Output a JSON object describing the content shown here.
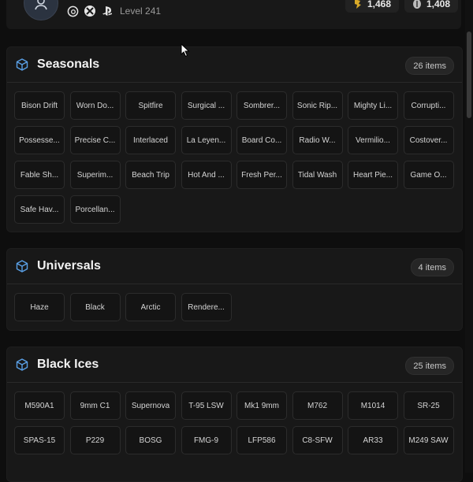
{
  "header": {
    "level_text": "Level 241",
    "platforms": [
      "ubisoft-icon",
      "xbox-icon",
      "playstation-icon"
    ],
    "currencies": [
      {
        "icon": "renown-icon",
        "value": "1,468"
      },
      {
        "icon": "credits-icon",
        "value": "1,408"
      }
    ]
  },
  "colors": {
    "accent_icon": "#5aa0e6",
    "chip_bg": "#141414",
    "panel_bg": "#181818"
  },
  "sections": [
    {
      "title": "Seasonals",
      "count": "26 items",
      "items": [
        "Bison Drift",
        "Worn Do...",
        "Spitfire",
        "Surgical ...",
        "Sombrer...",
        "Sonic Rip...",
        "Mighty Li...",
        "Corrupti...",
        "Possesse...",
        "Precise C...",
        "Interlaced",
        "La Leyen...",
        "Board Co...",
        "Radio W...",
        "Vermilio...",
        "Costover...",
        "Fable Sh...",
        "Superim...",
        "Beach Trip",
        "Hot And ...",
        "Fresh Per...",
        "Tidal Wash",
        "Heart Pie...",
        "Game O...",
        "Safe Hav...",
        "Porcellan..."
      ]
    },
    {
      "title": "Universals",
      "count": "4 items",
      "items": [
        "Haze",
        "Black",
        "Arctic",
        "Rendere..."
      ]
    },
    {
      "title": "Black Ices",
      "count": "25 items",
      "items": [
        "M590A1",
        "9mm C1",
        "Supernova",
        "T-95 LSW",
        "Mk1 9mm",
        "M762",
        "M1014",
        "SR-25",
        "SPAS-15",
        "P229",
        "BOSG",
        "FMG-9",
        "LFP586",
        "C8-SFW",
        "AR33",
        "M249 SAW"
      ]
    }
  ]
}
